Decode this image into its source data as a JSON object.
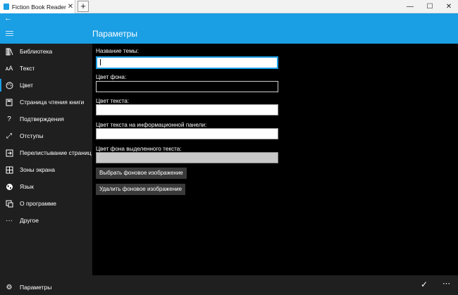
{
  "window": {
    "tab_title": "Fiction Book Reader",
    "tab_close": "✕",
    "new_tab": "+",
    "min": "—",
    "max": "☐",
    "close": "✕"
  },
  "header": {
    "back": "←",
    "title": "Параметры"
  },
  "sidebar": {
    "items": [
      {
        "label": "Библиотека",
        "icon": "library-icon"
      },
      {
        "label": "Текст",
        "icon": "font-size-icon"
      },
      {
        "label": "Цвет",
        "icon": "palette-icon"
      },
      {
        "label": "Страница чтения книги",
        "icon": "reading-page-icon"
      },
      {
        "label": "Подтверждения",
        "icon": "question-icon"
      },
      {
        "label": "Отступы",
        "icon": "resize-icon"
      },
      {
        "label": "Перелистывание страниц",
        "icon": "page-flip-icon"
      },
      {
        "label": "Зоны экрана",
        "icon": "grid-icon"
      },
      {
        "label": "Язык",
        "icon": "globe-icon"
      },
      {
        "label": "О программе",
        "icon": "about-icon"
      },
      {
        "label": "Другое",
        "icon": "more-icon"
      }
    ],
    "settings": {
      "label": "Параметры",
      "icon": "gear-icon"
    }
  },
  "form": {
    "theme_name_label": "Название темы:",
    "theme_name_value": "",
    "bg_color_label": "Цвет фона:",
    "text_color_label": "Цвет текста:",
    "info_text_color_label": "Цвет текста на информационной панели:",
    "selected_bg_label": "Цвет фона выделенного текста:",
    "choose_bg_button": "Выбрать фоновое изображение",
    "delete_bg_button": "Удалить фоновое изображение"
  },
  "bottombar": {
    "accept": "✓",
    "more": "⋯"
  },
  "colors": {
    "accent": "#1a9ee4",
    "sidebar": "#1f1f1f",
    "content": "#000000"
  }
}
